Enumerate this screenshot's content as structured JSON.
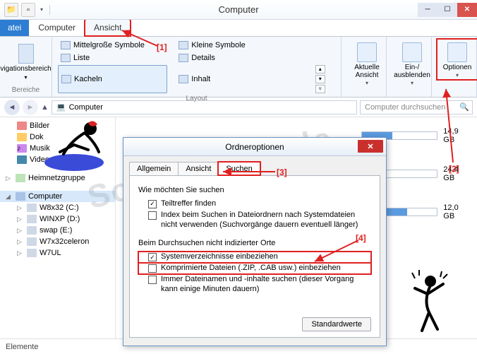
{
  "window": {
    "title": "Computer"
  },
  "qat": {
    "icon1": "folder-icon",
    "icon2": "page-icon"
  },
  "tabs": {
    "file": "atei",
    "computer": "Computer",
    "view": "Ansicht"
  },
  "ribbon": {
    "navpane": "vigationsbereich",
    "group_bereiche": "Bereiche",
    "group_layout": "Layout",
    "layout": {
      "medium": "Mittelgroße Symbole",
      "small": "Kleine Symbole",
      "list": "Liste",
      "details": "Details",
      "tiles": "Kacheln",
      "content": "Inhalt"
    },
    "current_view": "Aktuelle Ansicht",
    "show_hide": "Ein-/\nausblenden",
    "options": "Optionen"
  },
  "address": {
    "path": "Computer",
    "search_placeholder": "Computer durchsuchen"
  },
  "tree": {
    "pictures": "Bilder",
    "documents": "Dok",
    "music": "Musik",
    "videos": "Videos",
    "homegroup": "Heimnetzgruppe",
    "computer": "Computer",
    "drives": [
      {
        "label": "W8x32 (C:)"
      },
      {
        "label": "WINXP (D:)"
      },
      {
        "label": "swap (E:)"
      },
      {
        "label": "W7x32celeron"
      },
      {
        "label": "W7UL"
      }
    ]
  },
  "drives_main": [
    {
      "free": "14,9 GB",
      "fill": 40
    },
    {
      "free": "24,4 GB",
      "fill": 30
    },
    {
      "free": "12,0 GB",
      "fill": 60
    }
  ],
  "statusbar": "Elemente",
  "dialog": {
    "title": "Ordneroptionen",
    "tabs": {
      "general": "Allgemein",
      "view": "Ansicht",
      "search": "Suchen"
    },
    "sec1": "Wie möchten Sie suchen",
    "chk1": "Teiltreffer finden",
    "chk2": "Index beim Suchen in Dateiordnern nach Systemdateien nicht verwenden (Suchvorgänge dauern eventuell länger)",
    "sec2": "Beim Durchsuchen nicht indizierter Orte",
    "chk3": "Systemverzeichnisse einbeziehen",
    "chk4": "Komprimierte Dateien (.ZIP, .CAB usw.) einbeziehen",
    "chk5": "Immer Dateinamen und -inhalte suchen (dieser Vorgang kann einige Minuten dauern)",
    "defaults": "Standardwerte"
  },
  "annot": {
    "a1": "[1]",
    "a2": "[2]",
    "a3": "[3]",
    "a4": "[4]"
  },
  "watermark": "SoftwareOK.de"
}
